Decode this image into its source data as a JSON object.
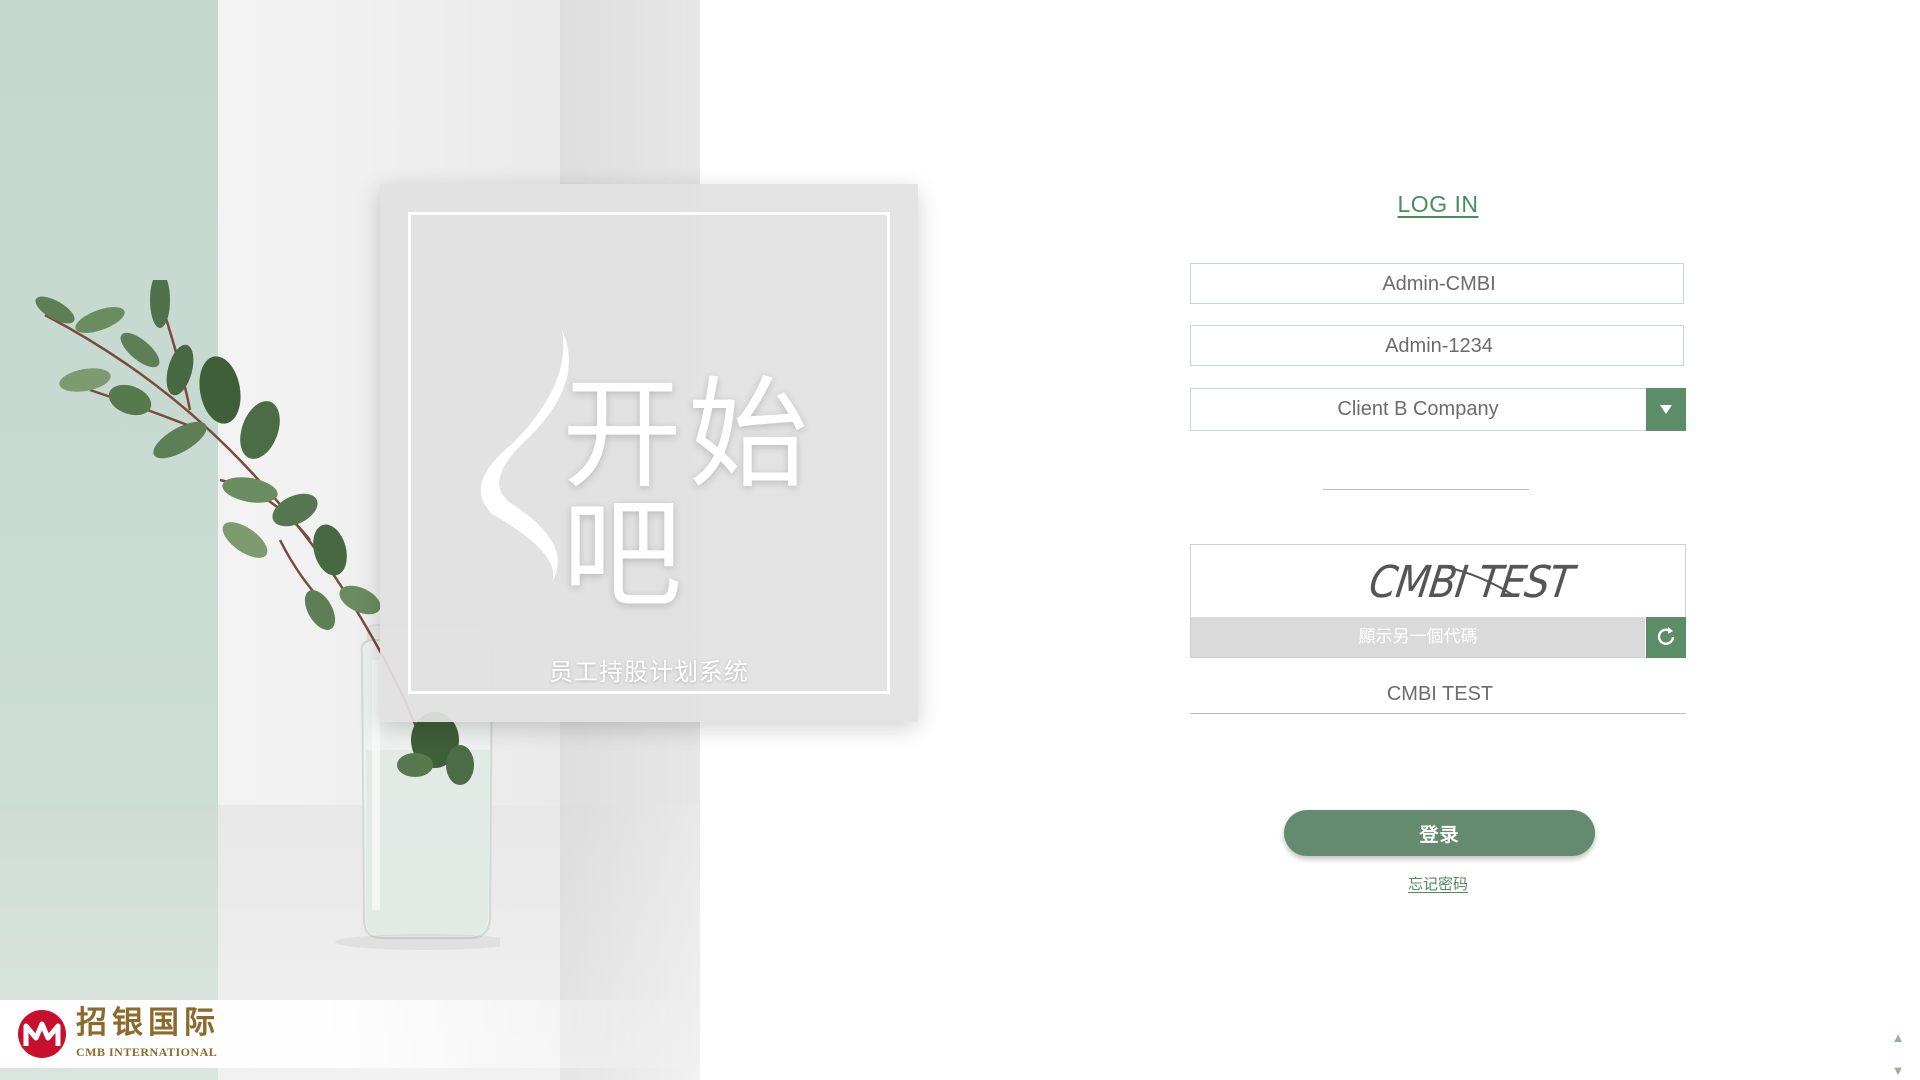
{
  "hero": {
    "title": "开始吧",
    "subtitle": "员工持股计划系统"
  },
  "brand": {
    "name_cn": "招银国际",
    "name_en": "CMB INTERNATIONAL",
    "color": "#8c6a2b",
    "logo_color": "#c8102e"
  },
  "login": {
    "title": "LOG IN",
    "username_value": "Admin-CMBI",
    "password_value": "Admin-1234",
    "company_selected": "Client B Company",
    "captcha_image_text": "CMBI TEST",
    "captcha_refresh_label": "顯示另一個代碼",
    "captcha_value": "CMBI TEST",
    "submit_label": "登录",
    "forgot_label": "忘记密码"
  },
  "icons": {
    "dropdown": "chevron-down-icon",
    "refresh": "refresh-icon",
    "scroll_up": "arrow-up-icon",
    "scroll_down": "arrow-down-icon"
  },
  "colors": {
    "accent": "#5d8c69",
    "link": "#4d8a5e",
    "button": "#648a6f",
    "mint": "#c4d8cf"
  }
}
